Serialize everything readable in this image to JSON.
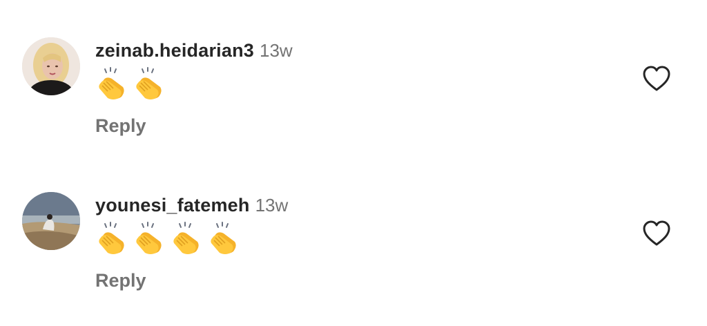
{
  "comments": [
    {
      "username": "zeinab.heidarian3",
      "time": "13w",
      "emoji_count": 2,
      "emoji": "clapping-hands",
      "reply_label": "Reply"
    },
    {
      "username": "younesi_fatemeh",
      "time": "13w",
      "emoji_count": 4,
      "emoji": "clapping-hands",
      "reply_label": "Reply"
    }
  ],
  "icons": {
    "like": "heart-outline-icon"
  },
  "colors": {
    "username": "#262626",
    "secondary": "#737373",
    "clap": "#FFC83D"
  }
}
